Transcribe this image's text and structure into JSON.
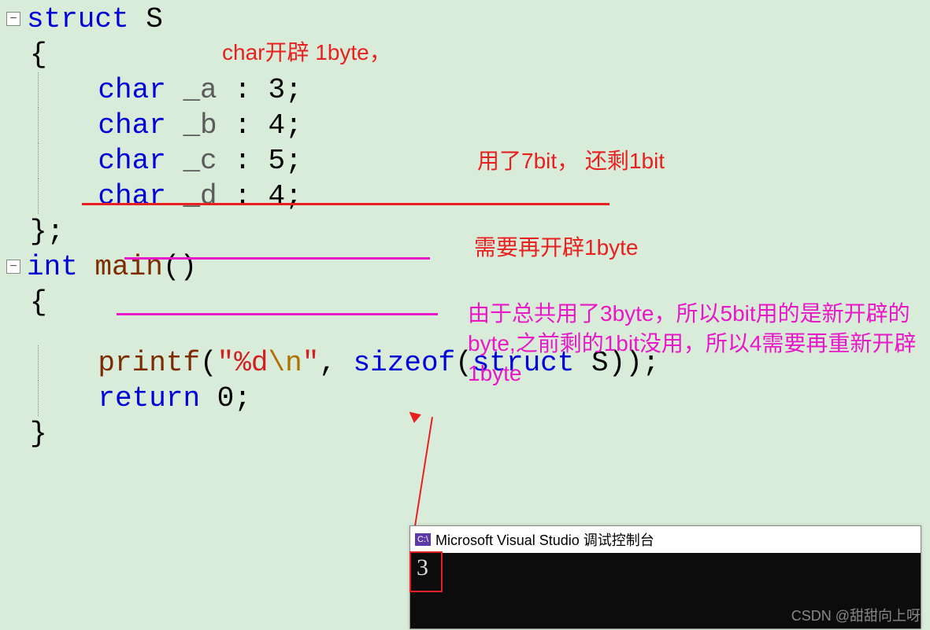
{
  "code": {
    "struct_kw": "struct",
    "struct_name": "S",
    "open_brace": "{",
    "field_a_kw": "char",
    "field_a_name": "_a",
    "field_a_bits": "3",
    "field_b_kw": "char",
    "field_b_name": "_b",
    "field_b_bits": "4",
    "field_c_kw": "char",
    "field_c_name": "_c",
    "field_c_bits": "5",
    "field_d_kw": "char",
    "field_d_name": "_d",
    "field_d_bits": "4",
    "close_struct": "};",
    "int_kw": "int",
    "main_name": "main",
    "main_parens": "()",
    "open_brace2": "{",
    "printf_name": "printf",
    "printf_open": "(",
    "fmt_open": "\"",
    "fmt_d": "%d",
    "fmt_nl": "\\n",
    "fmt_close": "\"",
    "comma": ", ",
    "sizeof_kw": "sizeof",
    "sizeof_open": "(",
    "struct_kw2": "struct",
    "struct_name2": "S",
    "sizeof_close": "));",
    "return_kw": "return",
    "return_val": "0",
    "return_semi": ";",
    "close_brace2": "}"
  },
  "annotations": {
    "top": "char开辟 1byte，",
    "mid1": "用了7bit， 还剩1bit",
    "mid2": "需要再开辟1byte",
    "bottom": "由于总共用了3byte，所以5bit用的是新开辟的byte,之前剩的1bit没用，所以4需要再重新开辟1byte"
  },
  "console": {
    "title": "Microsoft Visual Studio 调试控制台",
    "output": "3"
  },
  "watermark": "CSDN @甜甜向上呀"
}
